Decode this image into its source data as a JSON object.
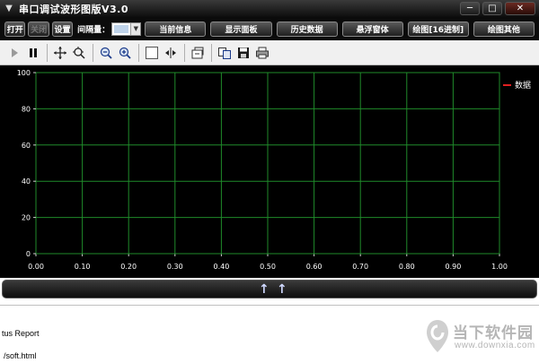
{
  "window": {
    "title": "串口调试波形图版V3.0",
    "minimize": "─",
    "maximize": "□",
    "close": "✕"
  },
  "toolbar1": {
    "open": "打开",
    "close": "关闭",
    "settings": "设置",
    "interval_label": "间隔量：",
    "buttons": [
      "当前信息",
      "显示面板",
      "历史数据",
      "悬浮窗体",
      "绘图[16进制]",
      "绘图其他"
    ]
  },
  "toolbar2": {
    "icons": [
      "play-icon",
      "pause-icon",
      "move-icon",
      "zoom-area-icon",
      "zoom-out-icon",
      "zoom-in-icon",
      "rectangle-icon",
      "fit-icon",
      "export-icon",
      "copy-icon",
      "save-icon",
      "print-icon"
    ]
  },
  "chart_data": {
    "type": "line",
    "x": [],
    "series": [
      {
        "name": "数据",
        "values": []
      }
    ],
    "xlim": [
      0,
      1
    ],
    "ylim": [
      0,
      100
    ],
    "x_ticks": [
      "0.00",
      "0.10",
      "0.20",
      "0.30",
      "0.40",
      "0.50",
      "0.60",
      "0.70",
      "0.80",
      "0.90",
      "1.00"
    ],
    "y_ticks": [
      "0",
      "20",
      "40",
      "60",
      "80",
      "100"
    ],
    "grid": true,
    "legend": "top-right",
    "colors": {
      "background": "#000000",
      "grid": "#1f8a2a",
      "axis_text": "#ffffff",
      "series": "#e02020"
    }
  },
  "scrollbar": {
    "arrows": [
      "↑",
      "↑"
    ]
  },
  "status": {
    "line1": "tus Report",
    "line2": "/soft.html"
  },
  "watermark": {
    "name": "当下软件园",
    "url": "www.downxia.com"
  }
}
